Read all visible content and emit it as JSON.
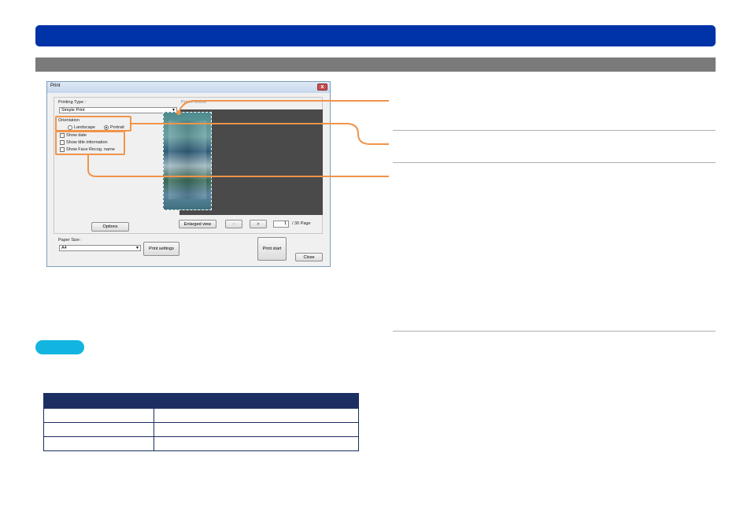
{
  "dialog": {
    "title": "Print",
    "close_glyph": "x",
    "printing_type_label": "Printing Type :",
    "printing_type_value": "Simple Print",
    "print_preview_label": "Print Preview",
    "orientation_label": "Orientation",
    "landscape_label": "Landscape",
    "portrait_label": "Portrait",
    "show_date_label": "Show date",
    "show_title_label": "Show title information",
    "show_face_label": "Show Face Recog. name",
    "options_button": "Options",
    "enlarged_view_button": "Enlarged view",
    "prev_button": "<",
    "next_button": ">",
    "page_number": "1",
    "page_total": "/ 30 Page",
    "paper_size_label": "Paper Size :",
    "paper_size_value": "A4",
    "print_settings_button": "Print settings",
    "print_start_button": "Print start",
    "close_button": "Close"
  },
  "colors": {
    "header_bar": "#0033a8",
    "section_bar": "#7a7a7a",
    "callout": "#f0944a",
    "pill": "#12b5df",
    "table_header": "#1c2f63"
  },
  "table": {
    "headers": [
      "",
      ""
    ],
    "rows": [
      [
        "",
        ""
      ],
      [
        "",
        ""
      ],
      [
        "",
        ""
      ]
    ]
  }
}
